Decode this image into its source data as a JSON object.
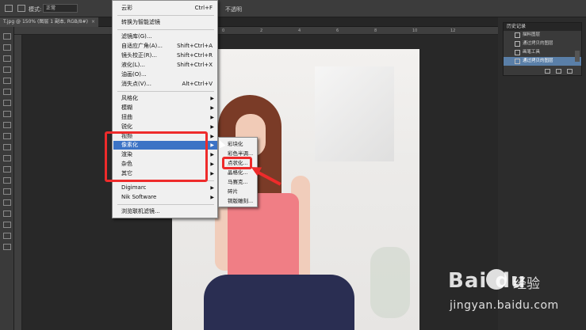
{
  "options_bar": {
    "mode_label": "模式:",
    "mode_value": "正常",
    "opacity_label": "不透明"
  },
  "document_tab": {
    "title": "T.jpg @ 150% (图层 1 副本, RGB/8#)",
    "close": "×"
  },
  "ruler": {
    "ticks": [
      "0",
      "2",
      "4",
      "6",
      "8",
      "10",
      "12"
    ]
  },
  "filter_menu": {
    "items": [
      {
        "label": "云彩",
        "shortcut": "Ctrl+F"
      },
      {
        "label": "转换为智能滤镜"
      },
      {
        "label": "滤镜库(G)..."
      },
      {
        "label": "自适应广角(A)...",
        "shortcut": "Shift+Ctrl+A"
      },
      {
        "label": "镜头校正(R)...",
        "shortcut": "Shift+Ctrl+R"
      },
      {
        "label": "液化(L)...",
        "shortcut": "Shift+Ctrl+X"
      },
      {
        "label": "油画(O)..."
      },
      {
        "label": "消失点(V)...",
        "shortcut": "Alt+Ctrl+V"
      },
      {
        "label": "风格化",
        "submenu": true
      },
      {
        "label": "模糊",
        "submenu": true
      },
      {
        "label": "扭曲",
        "submenu": true
      },
      {
        "label": "锐化",
        "submenu": true
      },
      {
        "label": "视频",
        "submenu": true
      },
      {
        "label": "像素化",
        "submenu": true,
        "highlighted": true
      },
      {
        "label": "渲染",
        "submenu": true
      },
      {
        "label": "杂色",
        "submenu": true
      },
      {
        "label": "其它",
        "submenu": true
      },
      {
        "label": "Digimarc",
        "submenu": true
      },
      {
        "label": "Nik Software",
        "submenu": true
      },
      {
        "label": "浏览联机滤镜..."
      }
    ]
  },
  "pixelate_submenu": {
    "items": [
      "彩块化",
      "彩色半调...",
      "点状化...",
      "晶格化...",
      "马赛克...",
      "碎片",
      "铜版雕刻..."
    ]
  },
  "history_panel": {
    "title": "历史记录",
    "items": [
      {
        "label": "描料图层",
        "selected": false
      },
      {
        "label": "通过拷贝的图层",
        "selected": false
      },
      {
        "label": "画笔工具",
        "selected": false
      },
      {
        "label": "通过拷贝的图层",
        "selected": true
      }
    ]
  },
  "watermark": {
    "logo": "Bai  du",
    "cn": "经验",
    "url": "jingyan.baidu.com"
  },
  "colors": {
    "menu_highlight": "#3c73c5",
    "annotation_red": "#ee2b2b",
    "history_selected": "#5a7fa8"
  }
}
